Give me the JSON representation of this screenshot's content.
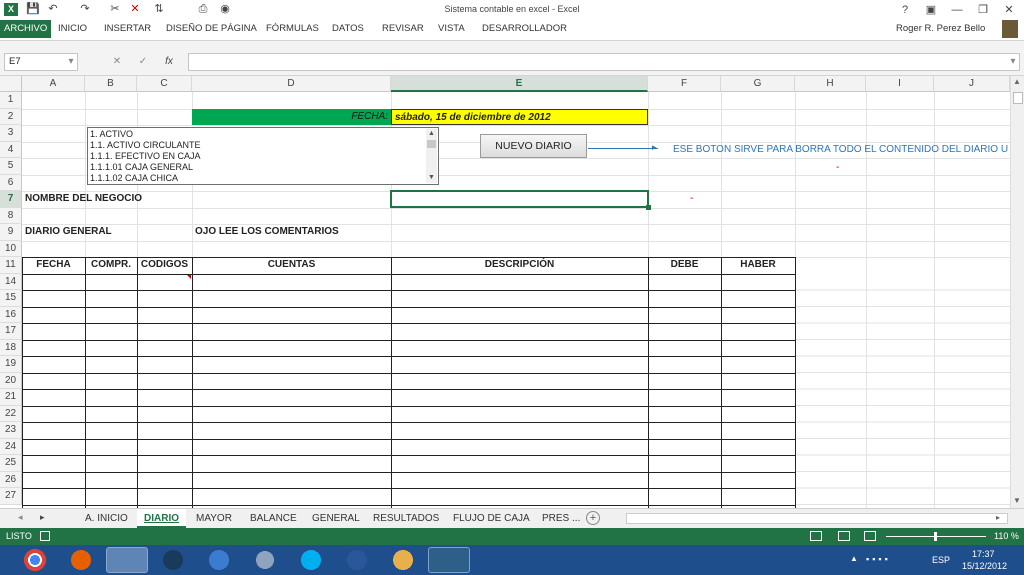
{
  "window": {
    "title": "Sistema contable en excel - Excel",
    "help_label": "?",
    "user": "Roger R. Perez Bello"
  },
  "ribbon_tabs": [
    "ARCHIVO",
    "INICIO",
    "INSERTAR",
    "DISEÑO DE PÁGINA",
    "FÓRMULAS",
    "DATOS",
    "REVISAR",
    "VISTA",
    "DESARROLLADOR"
  ],
  "formula_bar": {
    "name_box": "E7",
    "fx_label": "fx",
    "content": ""
  },
  "columns": [
    "A",
    "B",
    "C",
    "D",
    "E",
    "F",
    "G",
    "H",
    "I",
    "J"
  ],
  "selected_column": "E",
  "rows": [
    "1",
    "2",
    "3",
    "4",
    "5",
    "6",
    "7",
    "8",
    "9",
    "10",
    "11",
    "14",
    "15",
    "16",
    "17",
    "18",
    "19",
    "20",
    "21",
    "22",
    "23",
    "24",
    "25",
    "26",
    "27"
  ],
  "selected_row": "7",
  "cells": {
    "fecha_label": "FECHA:",
    "fecha_value": "sábado, 15 de diciembre de 2012",
    "nombre_negocio": "NOMBRE DEL NEGOCIO",
    "diario_general": "DIARIO GENERAL",
    "ojo_comentarios": "OJO LEE LOS COMENTARIOS",
    "comment_note": "ESE BOTON SIRVE PARA BORRA TODO EL CONTENIDO DEL DIARIO U",
    "dash_f7": "-",
    "dash_h5": "-"
  },
  "table_headers": [
    "FECHA",
    "COMPR.",
    "CODIGOS",
    "CUENTAS",
    "DESCRIPCIÓN",
    "DEBE",
    "HABER"
  ],
  "listbox_items": [
    "1. ACTIVO",
    "1.1. ACTIVO CIRCULANTE",
    "1.1.1. EFECTIVO EN CAJA",
    "1.1.1.01 CAJA GENERAL",
    "1.1.1.02 CAJA CHICA"
  ],
  "nuevo_button": "NUEVO DIARIO",
  "sheet_tabs": [
    "A. INICIO",
    "DIARIO",
    "MAYOR",
    "BALANCE",
    "GENERAL",
    "RESULTADOS",
    "FLUJO DE CAJA",
    "PRES ..."
  ],
  "active_sheet": "DIARIO",
  "status": {
    "mode": "LISTO",
    "zoom": "110 %"
  },
  "taskbar": {
    "language": "ESP",
    "time": "17:37",
    "date": "15/12/2012"
  },
  "colors": {
    "excel_green": "#217346",
    "fecha_bar": "#00a651",
    "fecha_value_bg": "#ffff00",
    "note_blue": "#2e75b6"
  }
}
